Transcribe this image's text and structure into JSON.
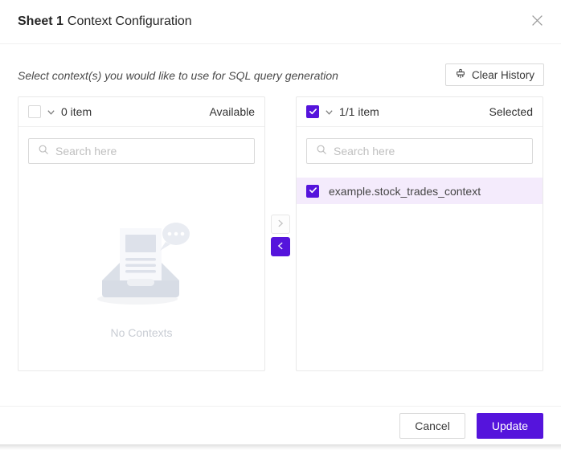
{
  "modal": {
    "title_bold": "Sheet 1",
    "title_rest": "Context Configuration",
    "subtitle": "Select context(s) you would like to use for SQL query generation",
    "clear_history_label": "Clear History"
  },
  "available_panel": {
    "select_all_checked": false,
    "count_label": "0 item",
    "panel_label": "Available",
    "search_placeholder": "Search here",
    "search_value": "",
    "empty_text": "No Contexts"
  },
  "selected_panel": {
    "select_all_checked": true,
    "count_label": "1/1 item",
    "panel_label": "Selected",
    "search_placeholder": "Search here",
    "search_value": "",
    "items": [
      {
        "label": "example.stock_trades_context",
        "checked": true
      }
    ]
  },
  "transfer": {
    "to_selected_enabled": false,
    "to_available_enabled": true
  },
  "footer": {
    "cancel_label": "Cancel",
    "update_label": "Update"
  },
  "icons": {
    "close": "✕",
    "clear_history": "broom",
    "search": "magnifier",
    "chevron_down": "∨",
    "check": "✓",
    "arrow_right": "›",
    "arrow_left": "‹"
  },
  "colors": {
    "accent": "#5514dc",
    "accent_row": "#f4ebfc",
    "border": "#d9d9d9",
    "panel_border": "#e9e9e9",
    "divider": "#f0f0f0"
  }
}
